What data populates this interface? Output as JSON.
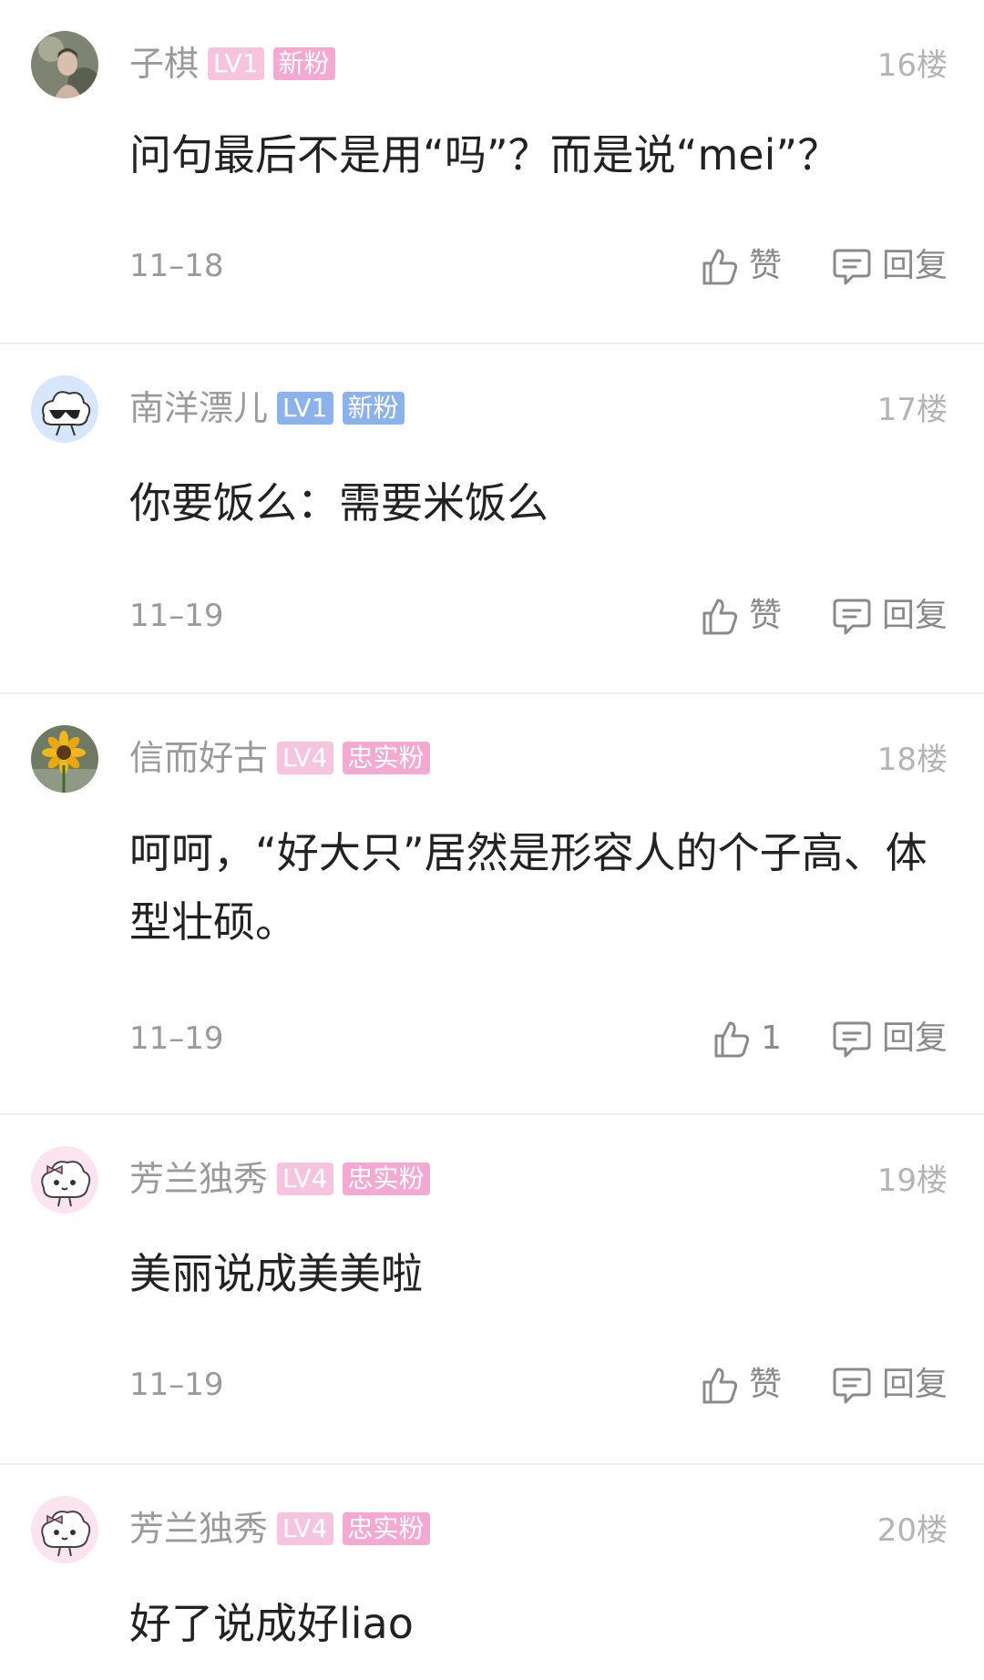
{
  "colors": {
    "badge_blue": "#8cb2ec",
    "badge_pink": "#f3a9d2",
    "badge_pink_light": "#f7c4e0"
  },
  "comments": [
    {
      "username": "子棋",
      "level": "LV1",
      "fan_badge": "新粉",
      "floor": "16楼",
      "content": "问句最后不是用“吗”？而是说“mei”？",
      "date": "11–18",
      "like_label": "赞",
      "reply_label": "回复"
    },
    {
      "username": "南洋漂儿",
      "level": "LV1",
      "fan_badge": "新粉",
      "floor": "17楼",
      "content": "你要饭么：需要米饭么",
      "date": "11–19",
      "like_label": "赞",
      "reply_label": "回复"
    },
    {
      "username": "信而好古",
      "level": "LV4",
      "fan_badge": "忠实粉",
      "floor": "18楼",
      "content": "呵呵，“好大只”居然是形容人的个子高、体型壮硕。",
      "date": "11–19",
      "like_label": "1",
      "reply_label": "回复"
    },
    {
      "username": "芳兰独秀",
      "level": "LV4",
      "fan_badge": "忠实粉",
      "floor": "19楼",
      "content": "美丽说成美美啦",
      "date": "11–19",
      "like_label": "赞",
      "reply_label": "回复"
    },
    {
      "username": "芳兰独秀",
      "level": "LV4",
      "fan_badge": "忠实粉",
      "floor": "20楼",
      "content": "好了说成好liao"
    }
  ]
}
